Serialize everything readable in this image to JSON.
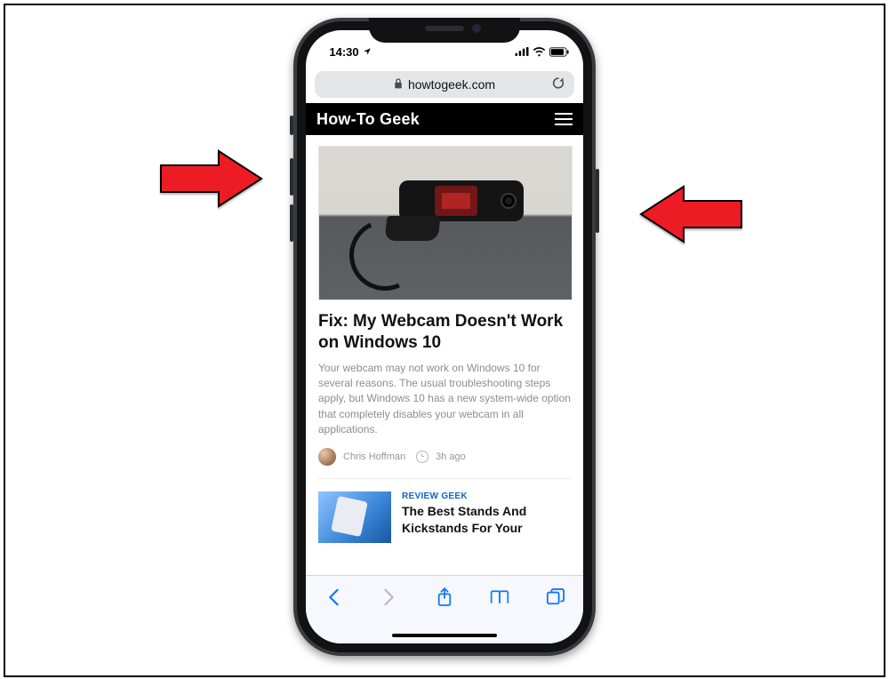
{
  "status": {
    "time": "14:30",
    "location_icon": "location-arrow",
    "signal": "cell-signal",
    "wifi": "wifi",
    "battery": "battery"
  },
  "urlbar": {
    "host": "howtogeek.com"
  },
  "site": {
    "title": "How-To Geek"
  },
  "article": {
    "title": "Fix: My Webcam Doesn't Work on Windows 10",
    "excerpt": "Your webcam may not work on Windows 10 for several reasons. The usual troubleshooting steps apply, but Windows 10 has a new system-wide option that completely disables your webcam in all applications.",
    "author": "Chris Hoffman",
    "time_ago": "3h ago"
  },
  "secondary": {
    "category": "REVIEW GEEK",
    "title": "The Best Stands And Kickstands For Your"
  },
  "accent_blue": "#0a7aff",
  "arrow_color": "#ed1c24"
}
